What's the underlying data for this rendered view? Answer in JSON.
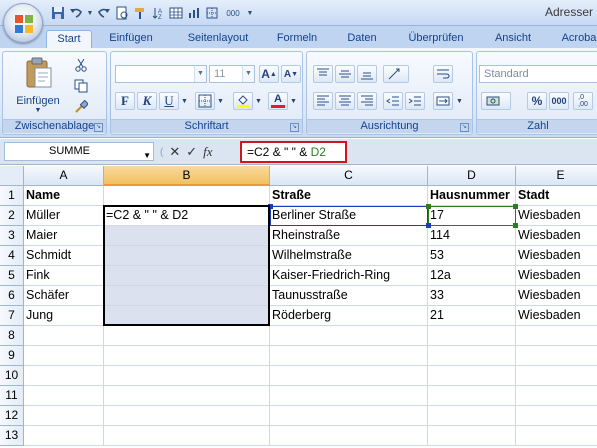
{
  "window": {
    "title": "Adresser"
  },
  "quick_access": [
    "save-icon",
    "undo-icon",
    "redo-icon",
    "print-preview-icon",
    "format-painter-icon",
    "sort-icon",
    "table-icon",
    "chart-icon",
    "border-icon",
    "number-format-icon",
    "customize-icon"
  ],
  "quick_access_number": "000",
  "tabs": [
    {
      "label": "Start",
      "active": true
    },
    {
      "label": "Einfügen"
    },
    {
      "label": "Seitenlayout"
    },
    {
      "label": "Formeln"
    },
    {
      "label": "Daten"
    },
    {
      "label": "Überprüfen"
    },
    {
      "label": "Ansicht"
    },
    {
      "label": "Acroba"
    }
  ],
  "ribbon": {
    "clipboard": {
      "label": "Zwischenablage",
      "paste_label": "Einfügen"
    },
    "font": {
      "label": "Schriftart",
      "font_size": "11",
      "bold": "F",
      "italic": "K",
      "underline": "U",
      "grow": "A",
      "shrink": "A",
      "font_color": "A"
    },
    "alignment": {
      "label": "Ausrichtung"
    },
    "number": {
      "label": "Zahl",
      "format": "Standard"
    }
  },
  "formula_bar": {
    "name_box": "SUMME",
    "cancel": "✕",
    "enter": "✓",
    "fx": "fx",
    "formula_prefix": "=",
    "formula_c2": "C2",
    "formula_mid": " & \" \" & ",
    "formula_d2": "D2"
  },
  "grid": {
    "columns": [
      "A",
      "B",
      "C",
      "D",
      "E"
    ],
    "selected_column": "B",
    "rows": [
      "1",
      "2",
      "3",
      "4",
      "5",
      "6",
      "7",
      "8",
      "9",
      "10",
      "11",
      "12",
      "13"
    ],
    "cells": {
      "A1": "Name",
      "C1": "Straße",
      "D1": "Hausnummer",
      "E1": "Stadt",
      "A2": "Müller",
      "B2": "=C2 & \" \" & D2",
      "C2": "Berliner Straße",
      "D2": "17",
      "E2": "Wiesbaden",
      "A3": "Maier",
      "C3": "Rheinstraße",
      "D3": "114",
      "E3": "Wiesbaden",
      "A4": "Schmidt",
      "C4": "Wilhelmstraße",
      "D4": "53",
      "E4": "Wiesbaden",
      "A5": "Fink",
      "C5": "Kaiser-Friedrich-Ring",
      "D5": "12a",
      "E5": "Wiesbaden",
      "A6": "Schäfer",
      "C6": "Taunusstraße",
      "D6": "33",
      "E6": "Wiesbaden",
      "A7": "Jung",
      "C7": "Röderberg",
      "D7": "21",
      "E7": "Wiesbaden"
    }
  },
  "colors": {
    "formula_highlight": "#d4141b",
    "ref_c2": "#1a3eb8",
    "ref_d2": "#2a7d20",
    "selection_fill": "#dbe1ef"
  }
}
